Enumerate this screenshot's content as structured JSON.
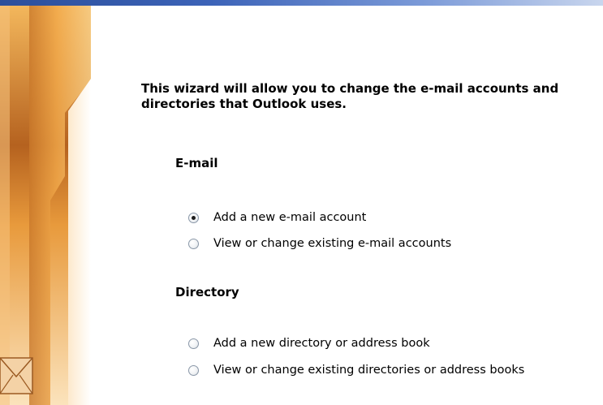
{
  "wizard": {
    "intro_text": "This wizard will allow you to change the e-mail accounts and directories that Outlook uses."
  },
  "email_section": {
    "heading": "E-mail",
    "options": [
      {
        "label": "Add a new e-mail account",
        "checked": true
      },
      {
        "label": "View or change existing e-mail accounts",
        "checked": false
      }
    ]
  },
  "directory_section": {
    "heading": "Directory",
    "options": [
      {
        "label": "Add a new directory or address book",
        "checked": false
      },
      {
        "label": "View or change existing directories or address books",
        "checked": false
      }
    ]
  },
  "colors": {
    "title_bar": "#2c4f9b",
    "side_art_primary": "#e89a3c",
    "side_art_dark": "#b5651d"
  },
  "icons": {
    "side_art": "office-decorative-banner",
    "envelope": "envelope-icon"
  }
}
